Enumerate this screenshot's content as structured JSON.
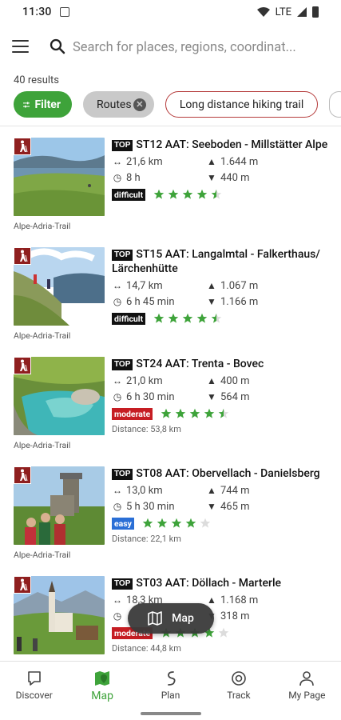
{
  "status_bar": {
    "time": "11:30",
    "network": "LTE"
  },
  "search": {
    "placeholder": "Search for places, regions, coordinat..."
  },
  "results_count": "40 results",
  "chips": {
    "filter": "Filter",
    "routes": "Routes",
    "category": "Long distance hiking trail"
  },
  "items": [
    {
      "top_badge": "TOP",
      "title": "ST12 AAT: Seeboden - Millstätter Alpe",
      "distance": "21,6 km",
      "ascent": "1.644 m",
      "duration": "8 h",
      "descent": "440 m",
      "difficulty": "difficult",
      "rating": 4.5,
      "caption": "Alpe-Adria-Trail",
      "distance_from": ""
    },
    {
      "top_badge": "TOP",
      "title": "ST15 AAT: Langalmtal - Falkerthaus/ Lärchenhütte",
      "distance": "14,7 km",
      "ascent": "1.067 m",
      "duration": "6 h 45 min",
      "descent": "1.166 m",
      "difficulty": "difficult",
      "rating": 4.5,
      "caption": "Alpe-Adria-Trail",
      "distance_from": ""
    },
    {
      "top_badge": "TOP",
      "title": "ST24 AAT: Trenta - Bovec",
      "distance": "21,0 km",
      "ascent": "400 m",
      "duration": "6 h 30 min",
      "descent": "564 m",
      "difficulty": "moderate",
      "rating": 4.5,
      "caption": "Alpe-Adria-Trail",
      "distance_from": "Distance: 53,8 km"
    },
    {
      "top_badge": "TOP",
      "title": "ST08 AAT: Obervellach - Danielsberg",
      "distance": "13,0 km",
      "ascent": "744 m",
      "duration": "5 h 30 min",
      "descent": "465 m",
      "difficulty": "easy",
      "rating": 4,
      "caption": "Alpe-Adria-Trail",
      "distance_from": "Distance: 22,1 km"
    },
    {
      "top_badge": "TOP",
      "title": "ST03 AAT: Döllach - Marterle",
      "distance": "18,3 km",
      "ascent": "1.168 m",
      "duration": "",
      "descent": "318 m",
      "difficulty": "moderate",
      "rating": 4,
      "caption": "",
      "distance_from": "Distance: 44,8 km"
    }
  ],
  "map_button": "Map",
  "bottom_nav": [
    "Discover",
    "Map",
    "Plan",
    "Track",
    "My Page"
  ],
  "colors": {
    "accent": "#3ea33a",
    "difficult": "#111111",
    "moderate": "#c61d23",
    "easy": "#2a6fd6",
    "hike_badge": "#8f1f1f"
  }
}
